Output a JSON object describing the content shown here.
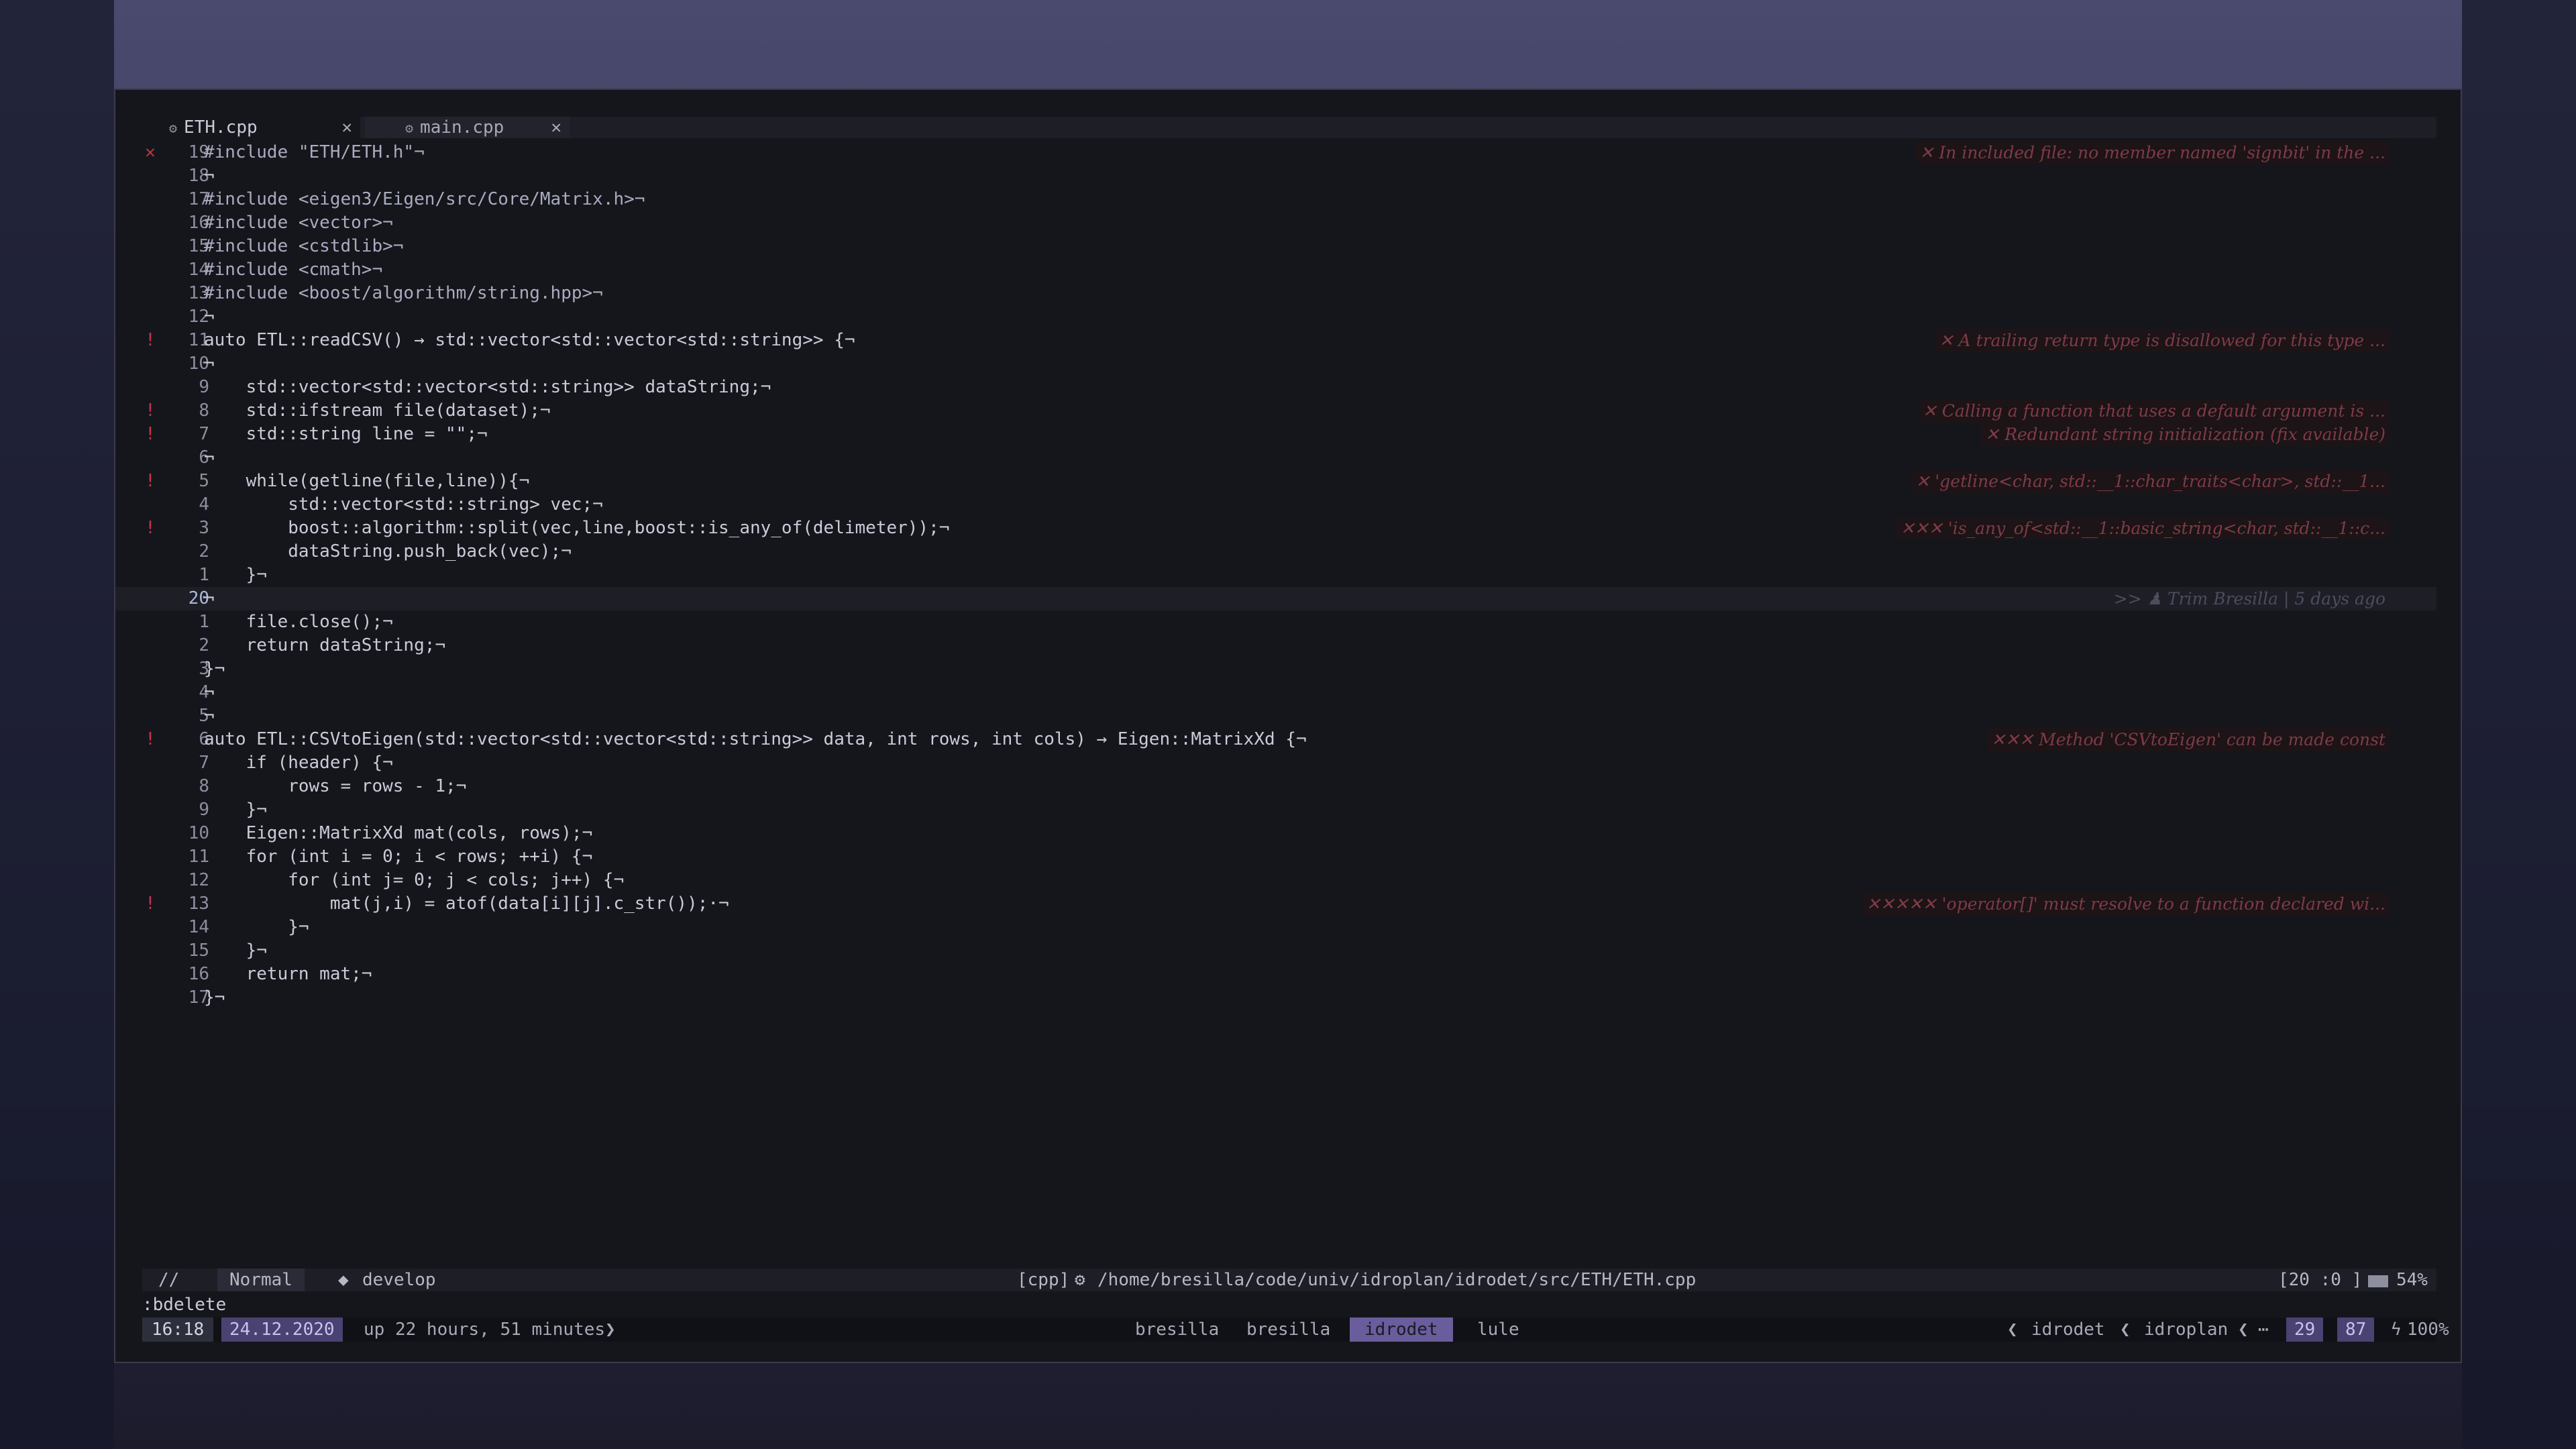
{
  "colors": {
    "accent": "#6a5d9c",
    "error": "#b5393d",
    "background": "#15161c"
  },
  "tabs": [
    {
      "icon": "gear-icon",
      "label": "ETH.cpp",
      "close": "✕"
    },
    {
      "icon": "gear-icon",
      "label": "main.cpp",
      "close": "✕"
    }
  ],
  "lines": [
    {
      "sign": "✕",
      "num": "19",
      "code": "#include \"ETH/ETH.h\"¬",
      "diag": "✕ In included file: no member named 'signbit' in the ..."
    },
    {
      "sign": "",
      "num": "18",
      "code": "¬"
    },
    {
      "sign": "",
      "num": "17",
      "code": "#include <eigen3/Eigen/src/Core/Matrix.h>¬"
    },
    {
      "sign": "",
      "num": "16",
      "code": "#include <vector>¬"
    },
    {
      "sign": "",
      "num": "15",
      "code": "#include <cstdlib>¬"
    },
    {
      "sign": "",
      "num": "14",
      "code": "#include <cmath>¬"
    },
    {
      "sign": "",
      "num": "13",
      "code": "#include <boost/algorithm/string.hpp>¬"
    },
    {
      "sign": "",
      "num": "12",
      "code": "¬"
    },
    {
      "sign": "!",
      "num": "11",
      "code": "auto ETL::readCSV() → std::vector<std::vector<std::string>> {¬",
      "diag": "✕ A trailing return type is disallowed for this type ..."
    },
    {
      "sign": "",
      "num": "10",
      "code": "¬"
    },
    {
      "sign": "",
      "num": "9",
      "code": "    std::vector<std::vector<std::string>> dataString;¬"
    },
    {
      "sign": "!",
      "num": "8",
      "code": "    std::ifstream file(dataset);¬",
      "diag": "✕ Calling a function that uses a default argument is ..."
    },
    {
      "sign": "!",
      "num": "7",
      "code": "    std::string line = \"\";¬",
      "diag": "✕ Redundant string initialization (fix available)"
    },
    {
      "sign": "",
      "num": "6",
      "code": "¬"
    },
    {
      "sign": "!",
      "num": "5",
      "code": "    while(getline(file,line)){¬",
      "diag": "✕ 'getline<char, std::__1::char_traits<char>, std::__1..."
    },
    {
      "sign": "",
      "num": "4",
      "code": "        std::vector<std::string> vec;¬"
    },
    {
      "sign": "!",
      "num": "3",
      "code": "        boost::algorithm::split(vec,line,boost::is_any_of(delimeter));¬",
      "diag": "✕✕✕ 'is_any_of<std::__1::basic_string<char, std::__1::c..."
    },
    {
      "sign": "",
      "num": "2",
      "code": "        dataString.push_back(vec);¬"
    },
    {
      "sign": "",
      "num": "1",
      "code": "    }¬"
    },
    {
      "sign": "",
      "num": "20",
      "code": "¬",
      "blame": ">> ♟ Trim Bresilla | 5 days ago",
      "current": true
    },
    {
      "sign": "",
      "num": "1",
      "code": "    file.close();¬"
    },
    {
      "sign": "",
      "num": "2",
      "code": "    return dataString;¬"
    },
    {
      "sign": "",
      "num": "3",
      "code": "}¬"
    },
    {
      "sign": "",
      "num": "4",
      "code": "¬"
    },
    {
      "sign": "",
      "num": "5",
      "code": "¬"
    },
    {
      "sign": "!",
      "num": "6",
      "code": "auto ETL::CSVtoEigen(std::vector<std::vector<std::string>> data, int rows, int cols) → Eigen::MatrixXd {¬",
      "diag": "✕✕✕ Method 'CSVtoEigen' can be made const"
    },
    {
      "sign": "",
      "num": "7",
      "code": "    if (header) {¬"
    },
    {
      "sign": "",
      "num": "8",
      "code": "        rows = rows - 1;¬"
    },
    {
      "sign": "",
      "num": "9",
      "code": "    }¬"
    },
    {
      "sign": "",
      "num": "10",
      "code": "    Eigen::MatrixXd mat(cols, rows);¬"
    },
    {
      "sign": "",
      "num": "11",
      "code": "    for (int i = 0; i < rows; ++i) {¬"
    },
    {
      "sign": "",
      "num": "12",
      "code": "        for (int j= 0; j < cols; j++) {¬"
    },
    {
      "sign": "!",
      "num": "13",
      "code": "            mat(j,i) = atof(data[i][j].c_str());·¬",
      "diag": "✕✕✕✕✕ 'operator[]' must resolve to a function declared wi..."
    },
    {
      "sign": "",
      "num": "14",
      "code": "        }¬"
    },
    {
      "sign": "",
      "num": "15",
      "code": "    }¬"
    },
    {
      "sign": "",
      "num": "16",
      "code": "    return mat;¬"
    },
    {
      "sign": "",
      "num": "17",
      "code": "}¬"
    }
  ],
  "statusline": {
    "left_marker": "//",
    "mode": "Normal",
    "branch_icon": "diamond-icon",
    "branch": "develop",
    "filetype": "[cpp]",
    "filepath": "/home/bresilla/code/univ/idroplan/idrodet/src/ETH/ETH.cpp",
    "position": "[20 :0 ]",
    "percent": "54%"
  },
  "cmdline": ":bdelete",
  "tmux": {
    "time": "16:18",
    "date": "24.12.2020",
    "uptime": "up 22 hours, 51 minutes",
    "windows": [
      "bresilla",
      "bresilla",
      "idrodet",
      "lule"
    ],
    "active_window": "idrodet",
    "right_path": [
      "idrodet",
      "idroplan",
      "⋯"
    ],
    "num1": "29",
    "num2": "87",
    "battery": "100%"
  }
}
